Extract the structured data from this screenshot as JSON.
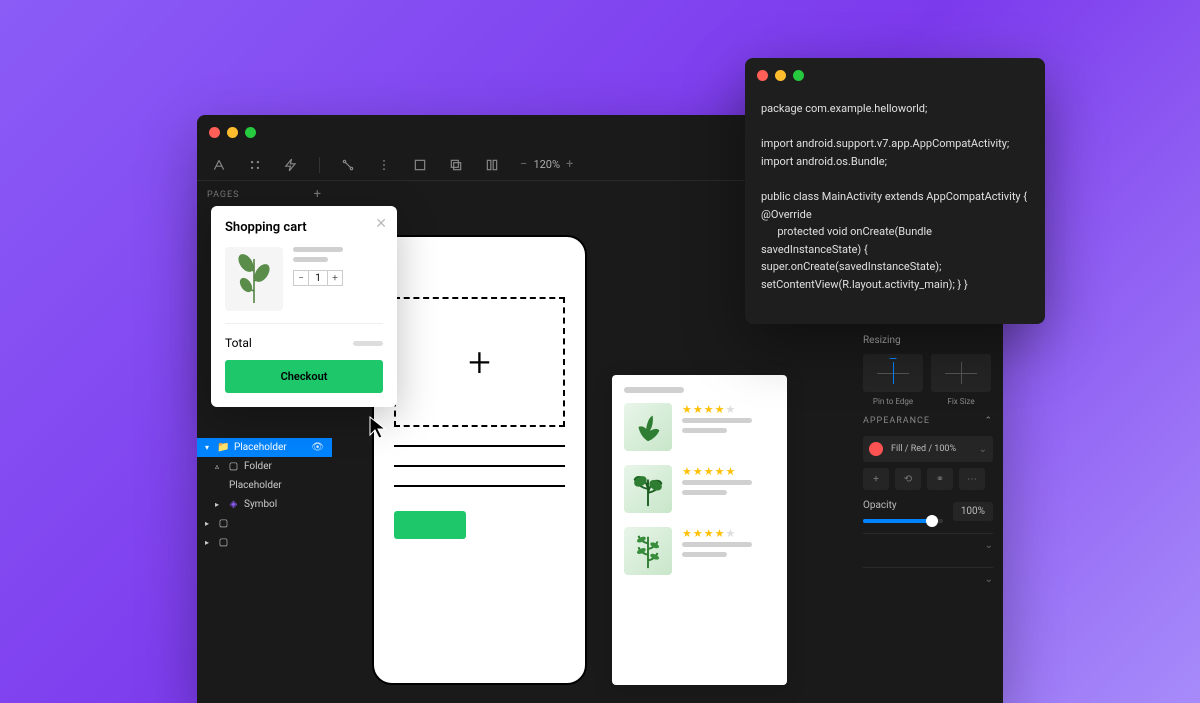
{
  "toolbar": {
    "zoom": "120%"
  },
  "sidebar": {
    "pages_label": "PAGES",
    "layers": [
      {
        "label": "Placeholder"
      },
      {
        "label": "Folder"
      },
      {
        "label": "Placeholder"
      },
      {
        "label": "Symbol"
      }
    ]
  },
  "cart": {
    "title": "Shopping cart",
    "quantity": "1",
    "total_label": "Total",
    "checkout_label": "Checkout"
  },
  "artboard1": {
    "plus": "+"
  },
  "products": {
    "ratings": [
      "4",
      "5",
      "4"
    ]
  },
  "inspector": {
    "resizing_label": "Resizing",
    "pin_label": "Pin to Edge",
    "fix_label": "Fix Size",
    "appearance_label": "APPEARANCE",
    "fill_label": "Fill / Red / 100%",
    "opacity_label": "Opacity",
    "opacity_value": "100%"
  },
  "code": {
    "lines": "package com.example.helloworld;\n\nimport android.support.v7.app.AppCompatActivity;\nimport android.os.Bundle;\n\npublic class MainActivity extends AppCompatActivity {\n@Override\n      protected void onCreate(Bundle savedInstanceState) {\nsuper.onCreate(savedInstanceState);\nsetContentView(R.layout.activity_main); } }"
  }
}
